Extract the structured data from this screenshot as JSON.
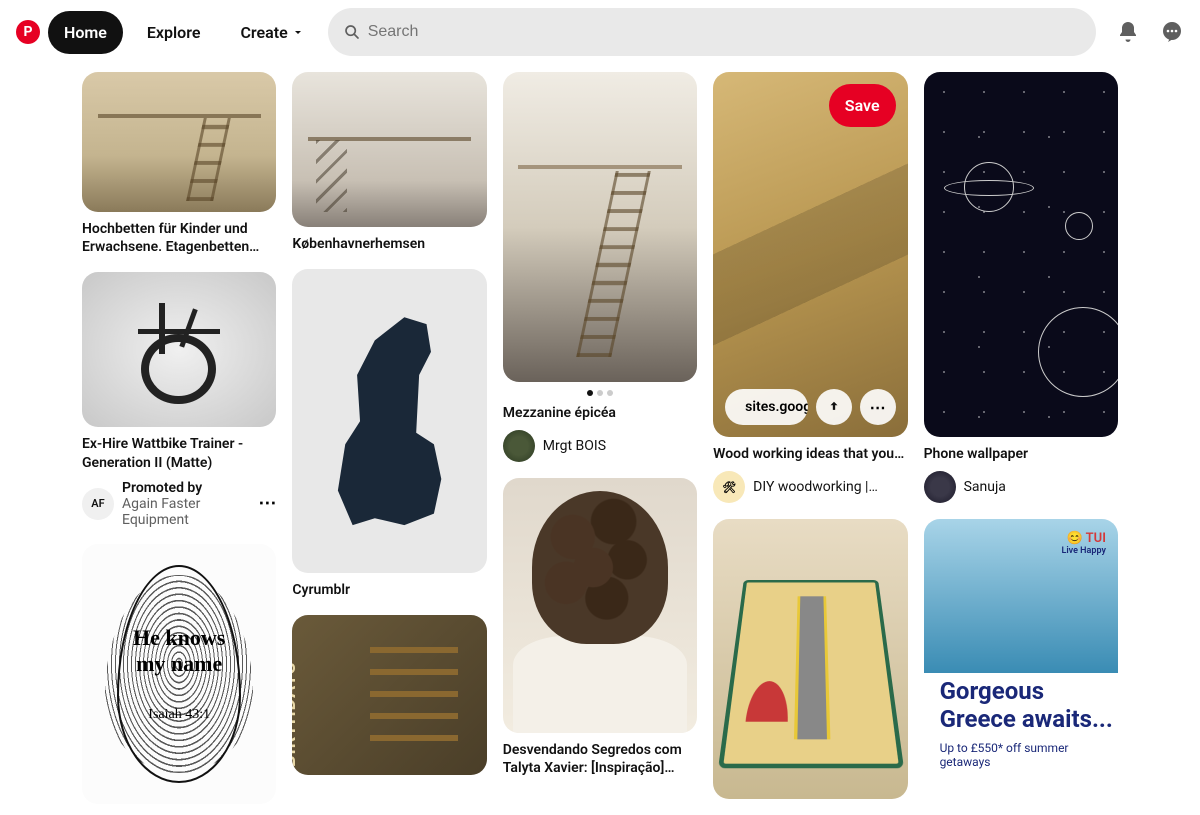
{
  "header": {
    "logo_letter": "P",
    "nav": {
      "home": "Home",
      "explore": "Explore",
      "create": "Create"
    },
    "search_placeholder": "Search"
  },
  "overlay": {
    "save": "Save",
    "link_text": "sites.googl..."
  },
  "pins": {
    "loft1": {
      "title": "Hochbetten für Kinder und Erwachsene. Etagenbetten aus…"
    },
    "loft2": {
      "title": "Københavnerhemsen"
    },
    "loft3": {
      "title": "Mezzanine épicéa",
      "user": "Mrgt BOIS"
    },
    "wood": {
      "title": "Wood working ideas that you…",
      "user": "DIY woodworking |…"
    },
    "space": {
      "title": "Phone wallpaper",
      "user": "Sanuja"
    },
    "bike": {
      "title": "Ex-Hire Wattbike Trainer - Generation II (Matte)",
      "promo_label": "Promoted by",
      "promoter": "Again Faster Equipment",
      "avatar": "AF"
    },
    "dino": {
      "title": "Cyrumblr"
    },
    "finger": {
      "line1": "He knows",
      "line2": "my name",
      "line3": "Isaiah 43:1"
    },
    "curly": {
      "title": "Desvendando Segredos com Talyta Xavier: [Inspiração]…"
    },
    "birth": {
      "text": "BIRTHDAYS"
    },
    "greece": {
      "brand": "TUI",
      "tagline": "Live Happy",
      "headline": "Gorgeous Greece awaits...",
      "sub": "Up to £550* off summer getaways"
    }
  }
}
